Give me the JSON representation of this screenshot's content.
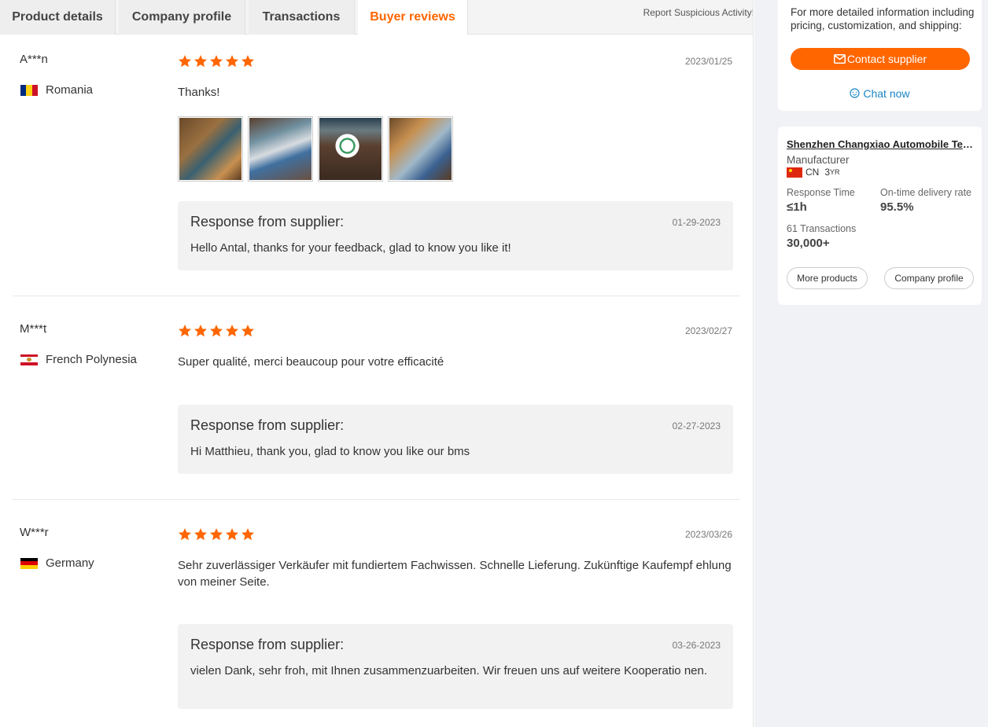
{
  "tabs": [
    {
      "label": "Product details",
      "active": false
    },
    {
      "label": "Company profile",
      "active": false
    },
    {
      "label": "Transactions",
      "active": false
    },
    {
      "label": "Buyer reviews",
      "active": true
    }
  ],
  "report_link": "Report Suspicious Activity!",
  "reviews": [
    {
      "name": "A***n",
      "country": "Romania",
      "flag_icon": "romania-flag-icon",
      "stars": 5,
      "date": "2023/01/25",
      "text": "Thanks!",
      "photo_count": 4,
      "response": {
        "title": "Response from supplier:",
        "date": "01-29-2023",
        "text": "Hello Antal, thanks for your feedback, glad to know you like it!"
      }
    },
    {
      "name": "M***t",
      "country": "French Polynesia",
      "flag_icon": "french-polynesia-flag-icon",
      "stars": 5,
      "date": "2023/02/27",
      "text": "Super qualité, merci beaucoup pour votre efficacité",
      "response": {
        "title": "Response from supplier:",
        "date": "02-27-2023",
        "text": "Hi Matthieu, thank you, glad to know you like our bms"
      }
    },
    {
      "name": "W***r",
      "country": "Germany",
      "flag_icon": "germany-flag-icon",
      "stars": 5,
      "date": "2023/03/26",
      "text": "Sehr zuverlässiger Verkäufer mit fundiertem Fachwissen. Schnelle Lieferung. Zukünftige Kaufempf ehlung von meiner Seite.",
      "response": {
        "title": "Response from supplier:",
        "date": "03-26-2023",
        "text": "vielen Dank, sehr froh, mit Ihnen zusammenzuarbeiten. Wir freuen uns auf weitere Kooperatio nen."
      }
    }
  ],
  "sidebar": {
    "info_text": "For more detailed information including pricing, customization, and shipping:",
    "contact_button": "Contact supplier",
    "chat_link": "Chat now",
    "company": {
      "name": "Shenzhen Changxiao Automobile Technology Co., Ltd.",
      "type": "Manufacturer",
      "country_code": "CN",
      "years": "3",
      "years_suffix": "YR",
      "response_time_label": "Response Time",
      "response_time_value": "≤1h",
      "ontime_label": "On-time delivery rate",
      "ontime_value": "95.5%",
      "transactions_label": "61 Transactions",
      "transactions_value": "30,000+",
      "more_products": "More products",
      "company_profile": "Company profile"
    }
  },
  "colors": {
    "accent": "#ff6600",
    "star": "#ff6600",
    "link": "#1a86c8"
  }
}
